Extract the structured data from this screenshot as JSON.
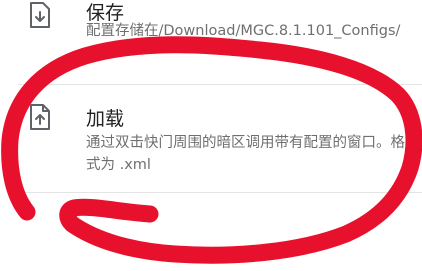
{
  "save": {
    "title": "保存",
    "description": "配置存储在/Download/MGC.8.1.101_Configs/",
    "icon": "download-file-icon"
  },
  "load": {
    "title": "加载",
    "description": "通过双击快门周围的暗区调用带有配置的窗口。格式为 .xml",
    "icon": "upload-file-icon"
  },
  "colors": {
    "annotation_red": "#e8112d",
    "icon_gray": "#5f6368",
    "text_primary": "#222222",
    "text_secondary": "#6f6f6f"
  }
}
